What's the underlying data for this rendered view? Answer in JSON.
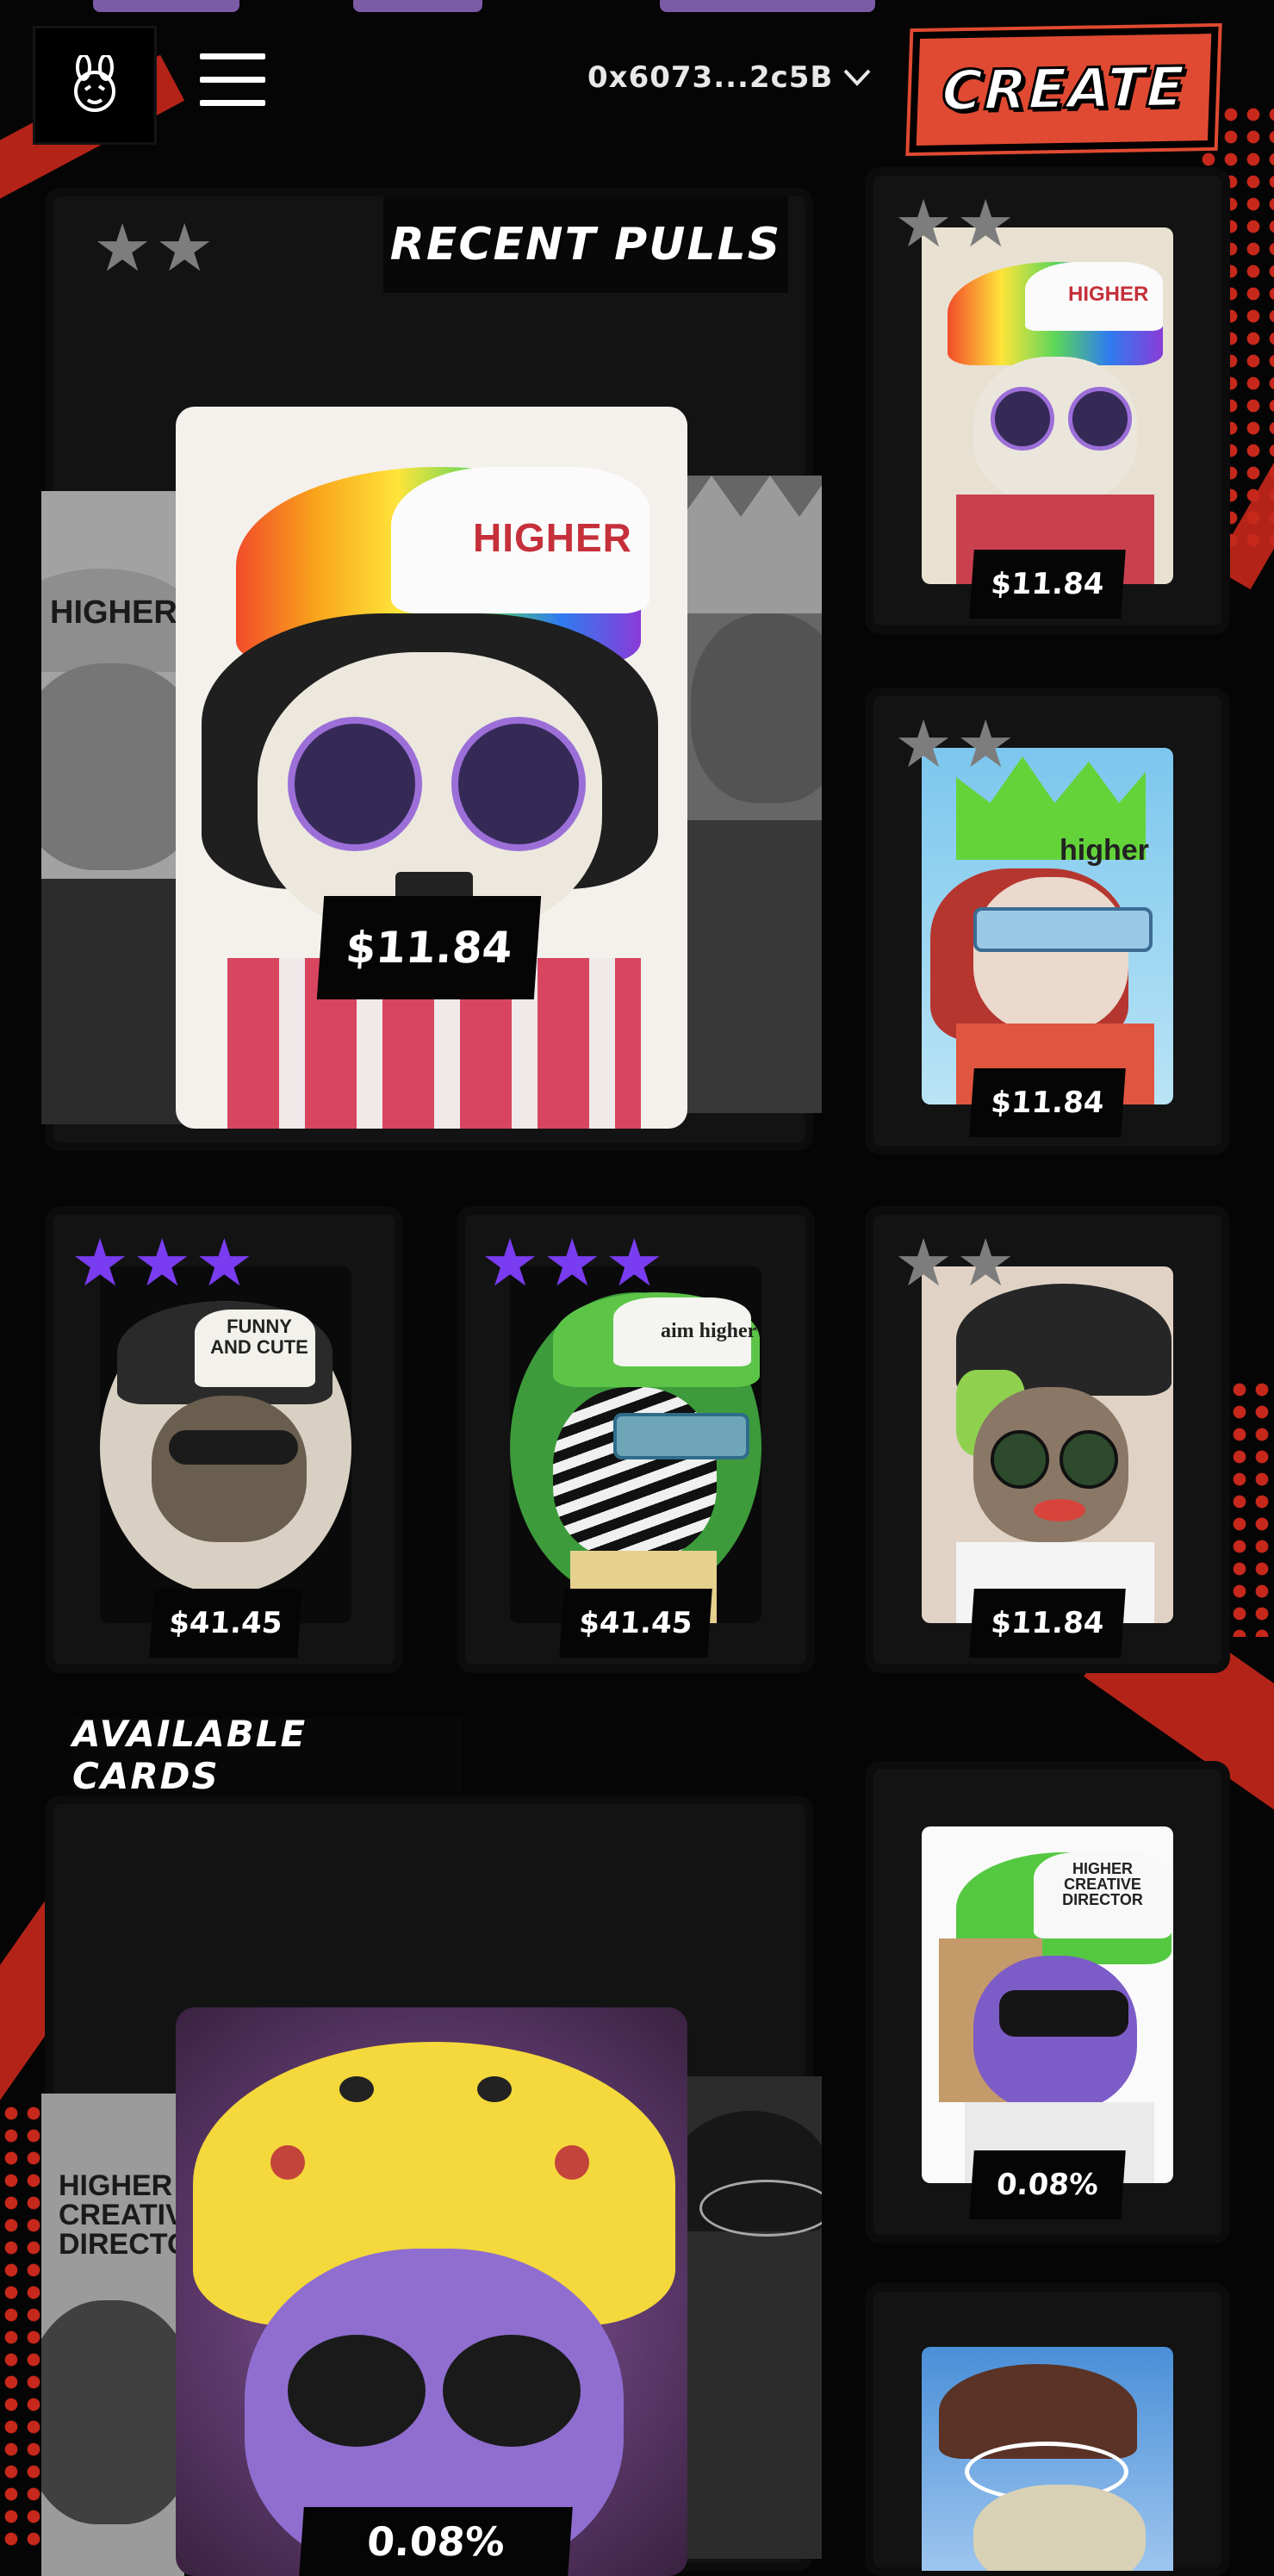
{
  "header": {
    "wallet_address": "0x6073...2c5B",
    "create_label": "CREATE",
    "logo_icon": "bunny-face-icon",
    "menu_icon": "hamburger-menu-icon"
  },
  "recent_pulls": {
    "title": "RECENT PULLS",
    "featured": {
      "stars": 2,
      "price": "$11.84",
      "cap_text": "HIGHER"
    },
    "side_left_cap_text": "HIGHER",
    "cards": [
      {
        "id": "rp1",
        "stars": 2,
        "price": "$11.84",
        "cap_text": "HIGHER"
      },
      {
        "id": "rp2",
        "stars": 2,
        "price": "$11.84",
        "cap_text": "higher"
      },
      {
        "id": "rp3",
        "stars": 3,
        "price": "$41.45",
        "cap_text": "FUNNY AND CUTE"
      },
      {
        "id": "rp4",
        "stars": 3,
        "price": "$41.45",
        "cap_text": "aim higher"
      },
      {
        "id": "rp5",
        "stars": 2,
        "price": "$11.84",
        "cap_text": ""
      }
    ]
  },
  "available_cards": {
    "title": "AVAILABLE CARDS",
    "featured": {
      "odds": "0.08%"
    },
    "side_left_cap_text": "HIGHER CREATIVE DIRECTOR",
    "cards": [
      {
        "id": "ac1",
        "odds": "0.08%",
        "cap_text": "HIGHER CREATIVE DIRECTOR"
      },
      {
        "id": "ac2",
        "odds": ""
      }
    ]
  },
  "colors": {
    "accent_red": "#e04a32",
    "star_purple": "#7a3cf0",
    "star_gray": "#7d7d7d",
    "bg": "#050505"
  }
}
